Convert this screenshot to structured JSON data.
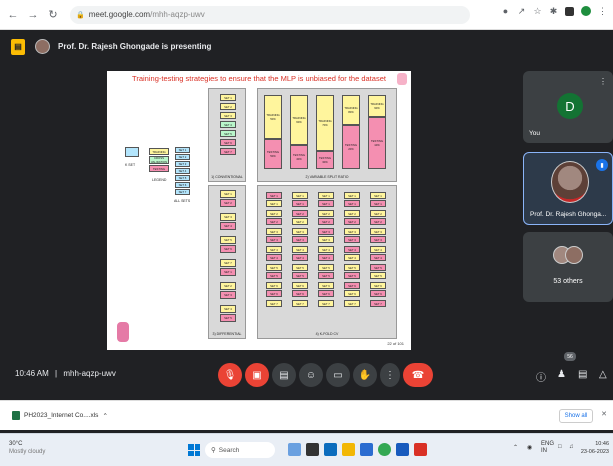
{
  "browser": {
    "url_host": "meet.google.com",
    "url_path": "/mhh-aqzp-uwv"
  },
  "presenting": {
    "text": "Prof. Dr. Rajesh Ghongade is presenting"
  },
  "slide": {
    "title": "Training-testing strategies to ensure that the MLP is unbiased for the dataset",
    "page": "22 of 101",
    "legend_items": [
      "TRAINING",
      "CROSS VALIDATION",
      "TESTING"
    ],
    "legend_label": "LEGEND",
    "k_set": "K SET",
    "all_sets": "ALL SETS",
    "set_labels": [
      "SET 1",
      "SET 2",
      "SET 3",
      "SET 4",
      "SET 5",
      "SET 6",
      "SET 7"
    ],
    "panels": {
      "conventional": "1) CONVENTIONAL",
      "variable_split": "2) VARIABLE SPLIT RATIO",
      "differential": "3) DIFFERENTIAL",
      "k_fold": "4) K-FOLD CV"
    },
    "vs_labels": {
      "training_pct": [
        "TRAINING 50%",
        "TRAINING 60%",
        "TRAINING 70%",
        "TRAINING 80%",
        "TRAINING 90%"
      ],
      "testing_pct": [
        "TESTING 50%",
        "TESTING 40%",
        "TESTING 30%",
        "TESTING 20%",
        "TESTING 10%"
      ]
    }
  },
  "participants": {
    "you": {
      "initial": "D",
      "label": "You"
    },
    "presenter": {
      "label": "Prof. Dr. Rajesh Ghonga..."
    },
    "others": {
      "label": "53 others"
    }
  },
  "bottom": {
    "time": "10:46 AM",
    "separator": "|",
    "code": "mhh-aqzp-uwv",
    "people_count": "56"
  },
  "download": {
    "filename": "PH2023_Internet Co....xls",
    "show_all": "Show all"
  },
  "taskbar": {
    "temp": "30°C",
    "weather": "Mostly cloudy",
    "search": "Search",
    "lang_top": "ENG",
    "lang_bottom": "IN",
    "time": "10:46",
    "date": "23-06-2023"
  },
  "colors": {
    "training": "#fff59d",
    "testing": "#f48fb1",
    "validation": "#b9f6ca",
    "end_call": "#ea4335",
    "meet_bg": "#202124"
  }
}
